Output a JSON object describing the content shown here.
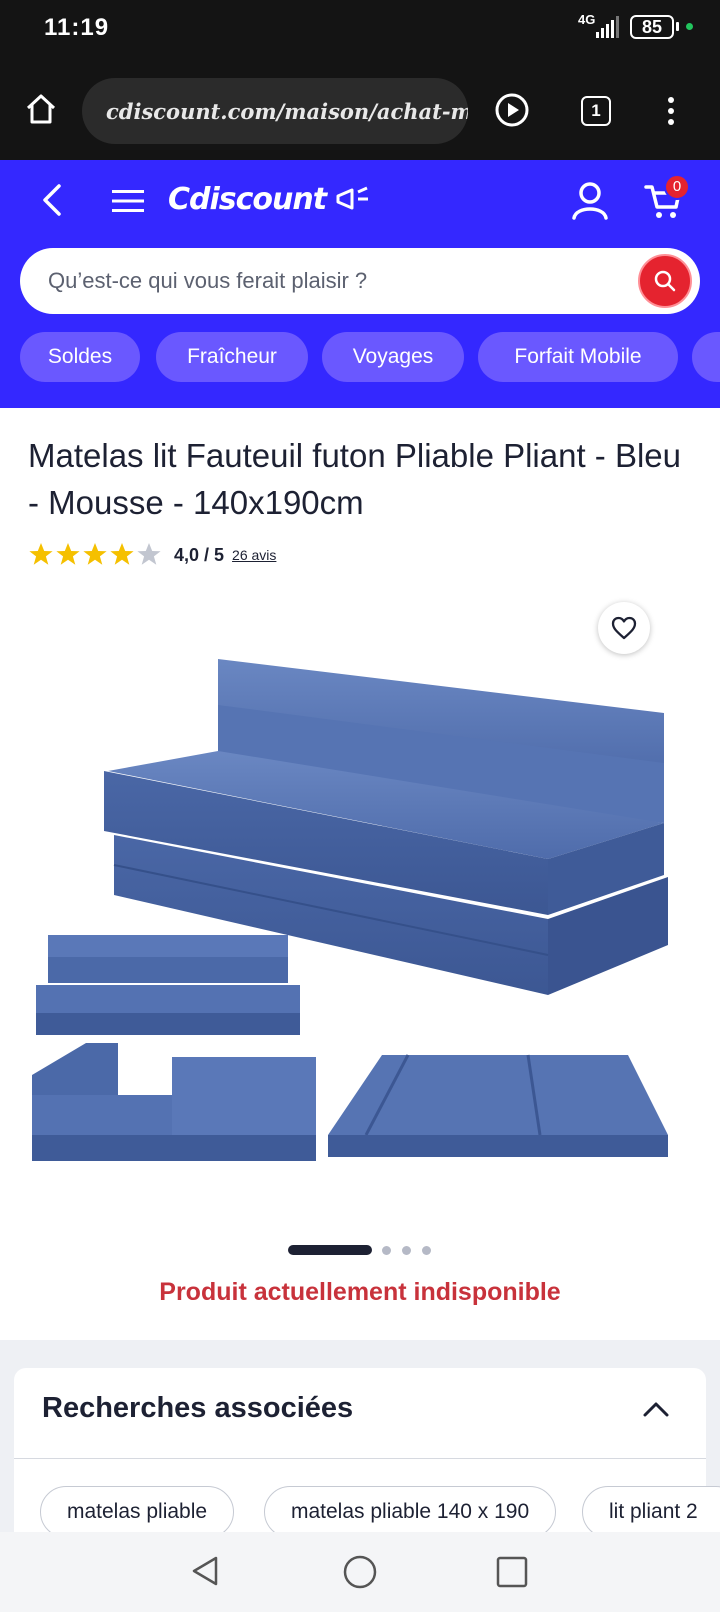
{
  "status_bar": {
    "time": "11:19",
    "network": "4G",
    "battery": "85"
  },
  "browser": {
    "url": "cdiscount.com/maison/achat-meubl",
    "tabs_count": "1"
  },
  "header": {
    "logo": "Cdiscount",
    "cart_count": "0",
    "search_placeholder": "Qu’est-ce qui vous ferait plaisir ?",
    "chips": [
      "Soldes",
      "Fraîcheur",
      "Voyages",
      "Forfait Mobile"
    ]
  },
  "product": {
    "title": "Matelas lit Fauteuil futon Pliable Pliant - Bleu - Mousse - 140x190cm",
    "rating_value": "4,0 / 5",
    "rating_stars": 4,
    "reviews": "26 avis",
    "availability": "Produit actuellement indisponible",
    "carousel_total": 4,
    "carousel_index": 1,
    "color": "#4a68a8"
  },
  "related": {
    "title": "Recherches associées",
    "tags": [
      "matelas pliable",
      "matelas pliable 140 x 190",
      "lit pliant 2"
    ]
  },
  "colors": {
    "brand_blue": "#3428ff",
    "accent_red": "#e5232f",
    "alert_red": "#c8323b",
    "star_yellow": "#f5c000"
  }
}
